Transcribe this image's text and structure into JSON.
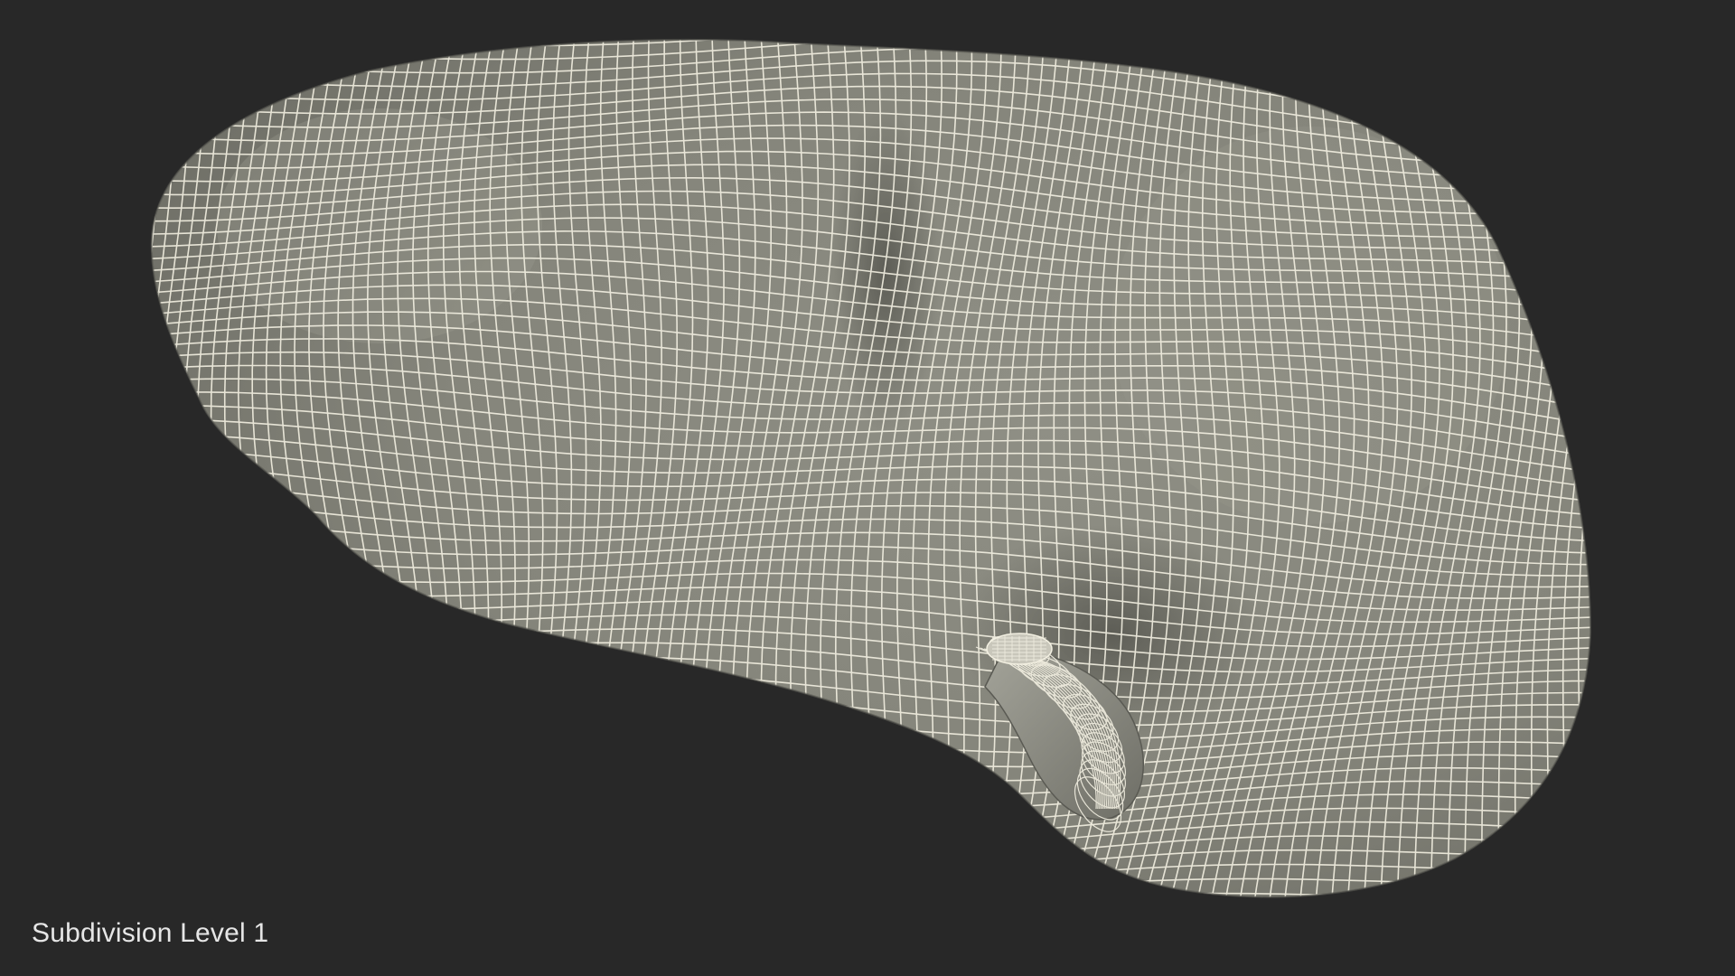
{
  "viewport": {
    "background_color": "#282828",
    "model_fill_color": "#8e8e84",
    "model_shadow_color": "#5f5f57",
    "wire_color": "#f3f0e2"
  },
  "caption": {
    "text": "Subdivision Level 1"
  }
}
